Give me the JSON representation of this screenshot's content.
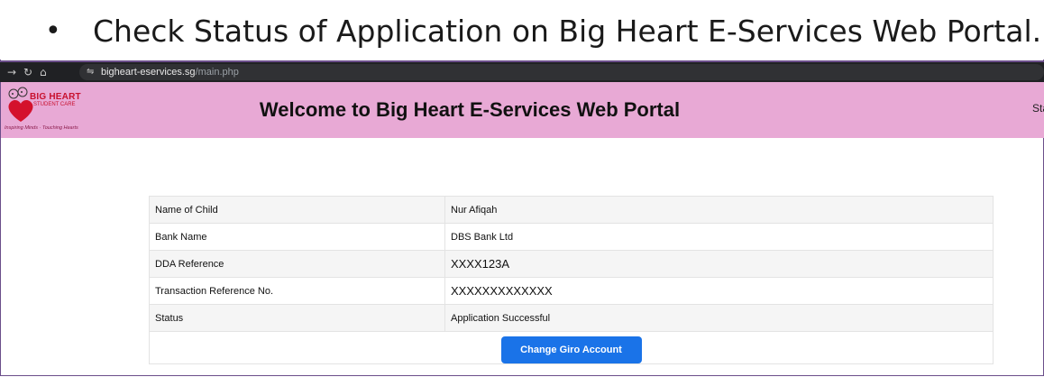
{
  "slide": {
    "bullet": "•",
    "title": "Check Status of Application on Big Heart E-Services Web Portal."
  },
  "browser": {
    "url_host": "bigheart-eservices.sg",
    "url_path": "/main.php",
    "icons": [
      "arrow-right-icon",
      "reload-icon",
      "home-icon",
      "site-settings-icon"
    ]
  },
  "site": {
    "logo_line1": "BIG HEART",
    "logo_line2": "STUDENT CARE",
    "logo_tagline": "Inspiring Minds · Touching Hearts",
    "welcome": "Welcome to Big Heart E-Services Web Portal",
    "right_clipped": "Sta",
    "header_color": "#e8a9d5"
  },
  "details": {
    "rows": [
      {
        "label": "Name of Child",
        "value": "Nur Afiqah"
      },
      {
        "label": "Bank Name",
        "value": "DBS Bank Ltd"
      },
      {
        "label": "DDA Reference",
        "value": "XXXX123A"
      },
      {
        "label": "Transaction Reference No.",
        "value": "XXXXXXXXXXXXX"
      },
      {
        "label": "Status",
        "value": "Application Successful"
      }
    ],
    "button_label": "Change Giro Account",
    "button_color": "#1a73e8"
  }
}
